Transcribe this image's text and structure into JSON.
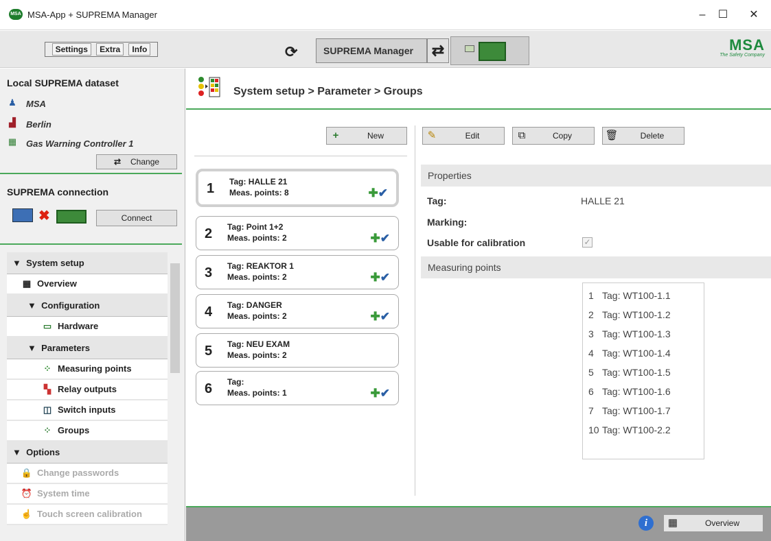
{
  "window": {
    "title": "MSA-App + SUPREMA Manager",
    "app_icon": "MSA",
    "minimize": "–",
    "maximize": "☐",
    "close": "✕"
  },
  "toolbar": {
    "menu": [
      "Settings",
      "Extra",
      "Info"
    ],
    "suprema_manager_label": "SUPREMA Manager",
    "logo_text": "MSA",
    "logo_subtitle": "The Safety Company"
  },
  "local_dataset": {
    "heading": "Local SUPREMA dataset",
    "items": [
      {
        "icon": "user-icon",
        "label": "MSA"
      },
      {
        "icon": "factory-icon",
        "label": "Berlin"
      },
      {
        "icon": "controller-icon",
        "label": "Gas Warning Controller 1"
      }
    ],
    "change_label": "Change"
  },
  "connection": {
    "heading": "SUPREMA connection",
    "connect_label": "Connect"
  },
  "nav": {
    "system_setup": "System setup",
    "overview": "Overview",
    "configuration": "Configuration",
    "hardware": "Hardware",
    "parameters": "Parameters",
    "measuring_points": "Measuring points",
    "relay_outputs": "Relay outputs",
    "switch_inputs": "Switch inputs",
    "groups": "Groups",
    "options": "Options",
    "change_passwords": "Change passwords",
    "system_time": "System time",
    "touch_calibration": "Touch screen calibration"
  },
  "breadcrumb": "System setup > Parameter > Groups",
  "actions": {
    "new": "New",
    "edit": "Edit",
    "copy": "Copy",
    "delete": "Delete"
  },
  "groups": [
    {
      "num": "1",
      "tag": "Tag:  HALLE 21",
      "meas": "Meas. points: 8",
      "calib": true,
      "selected": true
    },
    {
      "num": "2",
      "tag": "Tag: Point 1+2",
      "meas": "Meas. points: 2",
      "calib": true
    },
    {
      "num": "3",
      "tag": "Tag:  REAKTOR 1",
      "meas": "Meas. points: 2",
      "calib": true
    },
    {
      "num": "4",
      "tag": "Tag: DANGER",
      "meas": "Meas. points: 2",
      "calib": true
    },
    {
      "num": "5",
      "tag": "Tag: NEU EXAM",
      "meas": "Meas. points: 2",
      "calib": false
    },
    {
      "num": "6",
      "tag": "Tag:",
      "meas": "Meas. points: 1",
      "calib": true
    }
  ],
  "properties": {
    "heading": "Properties",
    "tag_label": "Tag:",
    "tag_value": "HALLE 21",
    "marking_label": "Marking:",
    "calib_label": "Usable for calibration",
    "calib_checked": true
  },
  "measuring_points": {
    "heading": "Measuring points",
    "items": [
      {
        "n": "1",
        "tag": "Tag: WT100-1.1"
      },
      {
        "n": "2",
        "tag": "Tag: WT100-1.2"
      },
      {
        "n": "3",
        "tag": "Tag: WT100-1.3"
      },
      {
        "n": "4",
        "tag": "Tag: WT100-1.4"
      },
      {
        "n": "5",
        "tag": "Tag: WT100-1.5"
      },
      {
        "n": "6",
        "tag": "Tag: WT100-1.6"
      },
      {
        "n": "7",
        "tag": "Tag: WT100-1.7"
      },
      {
        "n": "10",
        "tag": "Tag: WT100-2.2"
      }
    ]
  },
  "footer": {
    "overview_label": "Overview"
  },
  "colors": {
    "accent_green": "#4aa85a",
    "check_blue": "#2a5fa5",
    "info_blue": "#2f6fd0"
  }
}
